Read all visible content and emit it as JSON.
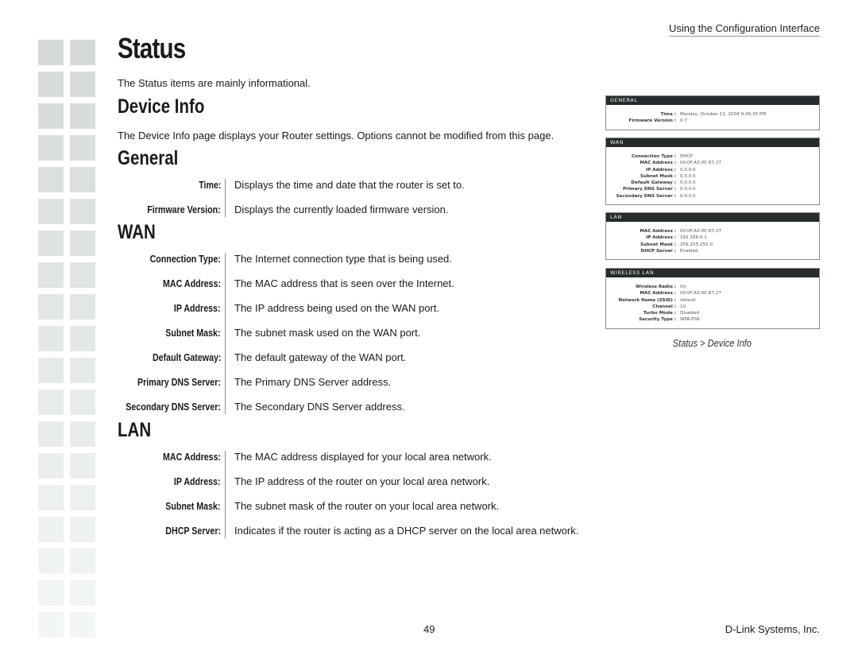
{
  "header": {
    "section": "Using the Configuration Interface"
  },
  "page": {
    "title": "Status",
    "intro": "The Status items are mainly informational.",
    "device_info": {
      "heading": "Device Info",
      "description": "The Device Info page displays your Router settings. Options cannot be modified from this page."
    },
    "general": {
      "heading": "General",
      "items": [
        {
          "label": "Time:",
          "desc": "Displays the time and date that the router is set to."
        },
        {
          "label": "Firmware Version:",
          "desc": "Displays the currently loaded firmware version."
        }
      ]
    },
    "wan": {
      "heading": "WAN",
      "items": [
        {
          "label": "Connection Type:",
          "desc": "The Internet connection type that is being used."
        },
        {
          "label": "MAC Address:",
          "desc": "The MAC address that is seen over the Internet."
        },
        {
          "label": "IP Address:",
          "desc": "The IP address being used on the WAN port."
        },
        {
          "label": "Subnet Mask:",
          "desc": "The subnet mask used on the WAN port."
        },
        {
          "label": "Default Gateway:",
          "desc": "The default gateway of the WAN port."
        },
        {
          "label": "Primary DNS Server:",
          "desc": "The Primary DNS Server address."
        },
        {
          "label": "Secondary DNS Server:",
          "desc": "The Secondary DNS Server address."
        }
      ]
    },
    "lan": {
      "heading": "LAN",
      "items": [
        {
          "label": "MAC Address:",
          "desc": "The MAC address displayed for your local area network."
        },
        {
          "label": "IP Address:",
          "desc": "The IP address of the router on your local area network."
        },
        {
          "label": "Subnet Mask:",
          "desc": "The subnet mask of the router on your local area network."
        },
        {
          "label": "DHCP Server:",
          "desc": "Indicates if the router is acting as a DHCP server on the local area network."
        }
      ]
    }
  },
  "screenshot": {
    "panels": [
      {
        "title": "GENERAL",
        "rows": [
          {
            "k": "Time :",
            "v": "Monday, October 11, 2004 9:26:35 PM"
          },
          {
            "k": "Firmware Version :",
            "v": "0.7"
          }
        ]
      },
      {
        "title": "WAN",
        "rows": [
          {
            "k": "Connection Type :",
            "v": "DHCP"
          },
          {
            "k": "MAC Address :",
            "v": "00:0F:A3:0C:87:27"
          },
          {
            "k": "IP Address :",
            "v": "0.0.0.0"
          },
          {
            "k": "Subnet Mask :",
            "v": "0.0.0.0"
          },
          {
            "k": "Default Gateway :",
            "v": "0.0.0.0"
          },
          {
            "k": "Primary DNS Server :",
            "v": "0.0.0.0"
          },
          {
            "k": "Secondary DNS Server :",
            "v": "0.0.0.0"
          }
        ]
      },
      {
        "title": "LAN",
        "rows": [
          {
            "k": "MAC Address :",
            "v": "00:0F:A3:0C:87:27"
          },
          {
            "k": "IP Address :",
            "v": "192.168.0.1"
          },
          {
            "k": "Subnet Mask :",
            "v": "255.255.255.0"
          },
          {
            "k": "DHCP Server :",
            "v": "Enabled"
          }
        ]
      },
      {
        "title": "WIRELESS LAN",
        "rows": [
          {
            "k": "Wireless Radio :",
            "v": "On"
          },
          {
            "k": "MAC Address :",
            "v": "00:0F:A3:0C:87:27"
          },
          {
            "k": "Network Name (SSID) :",
            "v": "default"
          },
          {
            "k": "Channel :",
            "v": "10"
          },
          {
            "k": "Turbo Mode :",
            "v": "Disabled"
          },
          {
            "k": "Security Type :",
            "v": "WPA-PSK"
          }
        ]
      }
    ],
    "caption": "Status > Device Info"
  },
  "footer": {
    "page_number": "49",
    "company": "D-Link Systems, Inc."
  },
  "colors": {
    "panel_header": "#262b2d",
    "deco_square_top": "#d6d9db",
    "deco_square_bottom": "#f1f2f3"
  }
}
